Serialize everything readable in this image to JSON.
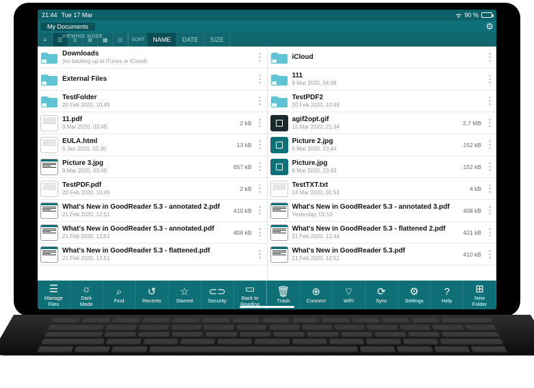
{
  "status": {
    "time": "21:44",
    "date": "Tue 17 Mar",
    "battery_pct": "90 %",
    "battery_fill": 90
  },
  "breadcrumb": {
    "title": "My Documents"
  },
  "viewing_mode_label": "VIEWING MODE",
  "sort": {
    "label": "SORT",
    "name": "NAME",
    "date": "DATE",
    "size": "SIZE"
  },
  "left_column": [
    {
      "type": "folder",
      "name": "Downloads",
      "sub": "(no backing up to iTunes or iCloud)",
      "size": ""
    },
    {
      "type": "folder",
      "name": "External Files",
      "sub": "",
      "size": ""
    },
    {
      "type": "folder",
      "name": "TestFolder",
      "sub": "20 Feb 2020, 10:49",
      "size": ""
    },
    {
      "type": "doc",
      "name": "11.pdf",
      "sub": "9 Mar 2020, 03:49",
      "size": "2 kB"
    },
    {
      "type": "doc",
      "name": "EULA.html",
      "sub": "5 Jan 2020, 02:30",
      "size": "13 kB"
    },
    {
      "type": "docpreview",
      "name": "Picture 3.jpg",
      "sub": "9 Mar 2020, 03:49",
      "size": "657 kB"
    },
    {
      "type": "doc",
      "name": "TestPDF.pdf",
      "sub": "20 Feb 2020, 10:49",
      "size": "2 kB"
    },
    {
      "type": "docpreview",
      "name": "What's New in GoodReader 5.3 - annotated 2.pdf",
      "sub": "21 Feb 2020, 12:51",
      "size": "410 kB"
    },
    {
      "type": "docpreview",
      "name": "What's New in GoodReader 5.3 - annotated.pdf",
      "sub": "21 Feb 2020, 12:51",
      "size": "406 kB"
    },
    {
      "type": "docpreview",
      "name": "What's New in GoodReader 5.3 - flattened.pdf",
      "sub": "21 Feb 2020, 12:51",
      "size": ""
    }
  ],
  "right_column": [
    {
      "type": "folder",
      "name": "iCloud",
      "sub": "",
      "size": ""
    },
    {
      "type": "folder",
      "name": "111",
      "sub": "9 Mar 2020, 04:08",
      "size": ""
    },
    {
      "type": "folder",
      "name": "TestPDF2",
      "sub": "20 Feb 2020, 10:49",
      "size": ""
    },
    {
      "type": "imgdark",
      "name": "agif2opt.gif",
      "sub": "15 Mar 2020, 21:34",
      "size": "2,7 MB"
    },
    {
      "type": "img",
      "name": "Picture 2.jpg",
      "sub": "6 Mar 2020, 23:44",
      "size": "152 kB"
    },
    {
      "type": "img",
      "name": "Picture.jpg",
      "sub": "6 Mar 2020, 23:43",
      "size": "152 kB"
    },
    {
      "type": "doc",
      "name": "TestTXT.txt",
      "sub": "14 Mar 2020, 01:53",
      "size": "4 kB"
    },
    {
      "type": "docpreview",
      "name": "What's New in GoodReader 5.3 - annotated 3.pdf",
      "sub": "Yesterday, 01:53",
      "size": "408 kB"
    },
    {
      "type": "docpreview",
      "name": "What's New in GoodReader 5.3 - flattened 2.pdf",
      "sub": "21 Feb 2020, 12:44",
      "size": "421 kB"
    },
    {
      "type": "docpreview",
      "name": "What's New in GoodReader 5.3.pdf",
      "sub": "21 Feb 2020, 12:51",
      "size": "410 kB"
    }
  ],
  "toolbar": [
    {
      "id": "manage",
      "label": "Manage\nFiles",
      "icon": "☰"
    },
    {
      "id": "dark",
      "label": "Dark\nMode",
      "icon": "☼"
    },
    {
      "id": "find",
      "label": "Find",
      "icon": "⌕"
    },
    {
      "id": "recents",
      "label": "Recents",
      "icon": "↺"
    },
    {
      "id": "starred",
      "label": "Starred",
      "icon": "☆"
    },
    {
      "id": "security",
      "label": "Security",
      "icon": "⊂⊃"
    },
    {
      "id": "back",
      "label": "Back to\nReading",
      "icon": "▭"
    },
    {
      "id": "trash",
      "label": "Trash",
      "icon": "🗑"
    },
    {
      "id": "connect",
      "label": "Connect",
      "icon": "⊕"
    },
    {
      "id": "wifi",
      "label": "WiFi",
      "icon": "⌔"
    },
    {
      "id": "sync",
      "label": "Sync",
      "icon": "⟳"
    },
    {
      "id": "settings",
      "label": "Settings",
      "icon": "⚙"
    },
    {
      "id": "help",
      "label": "Help",
      "icon": "?"
    },
    {
      "id": "newfolder",
      "label": "New\nFolder",
      "icon": "⊞"
    }
  ]
}
